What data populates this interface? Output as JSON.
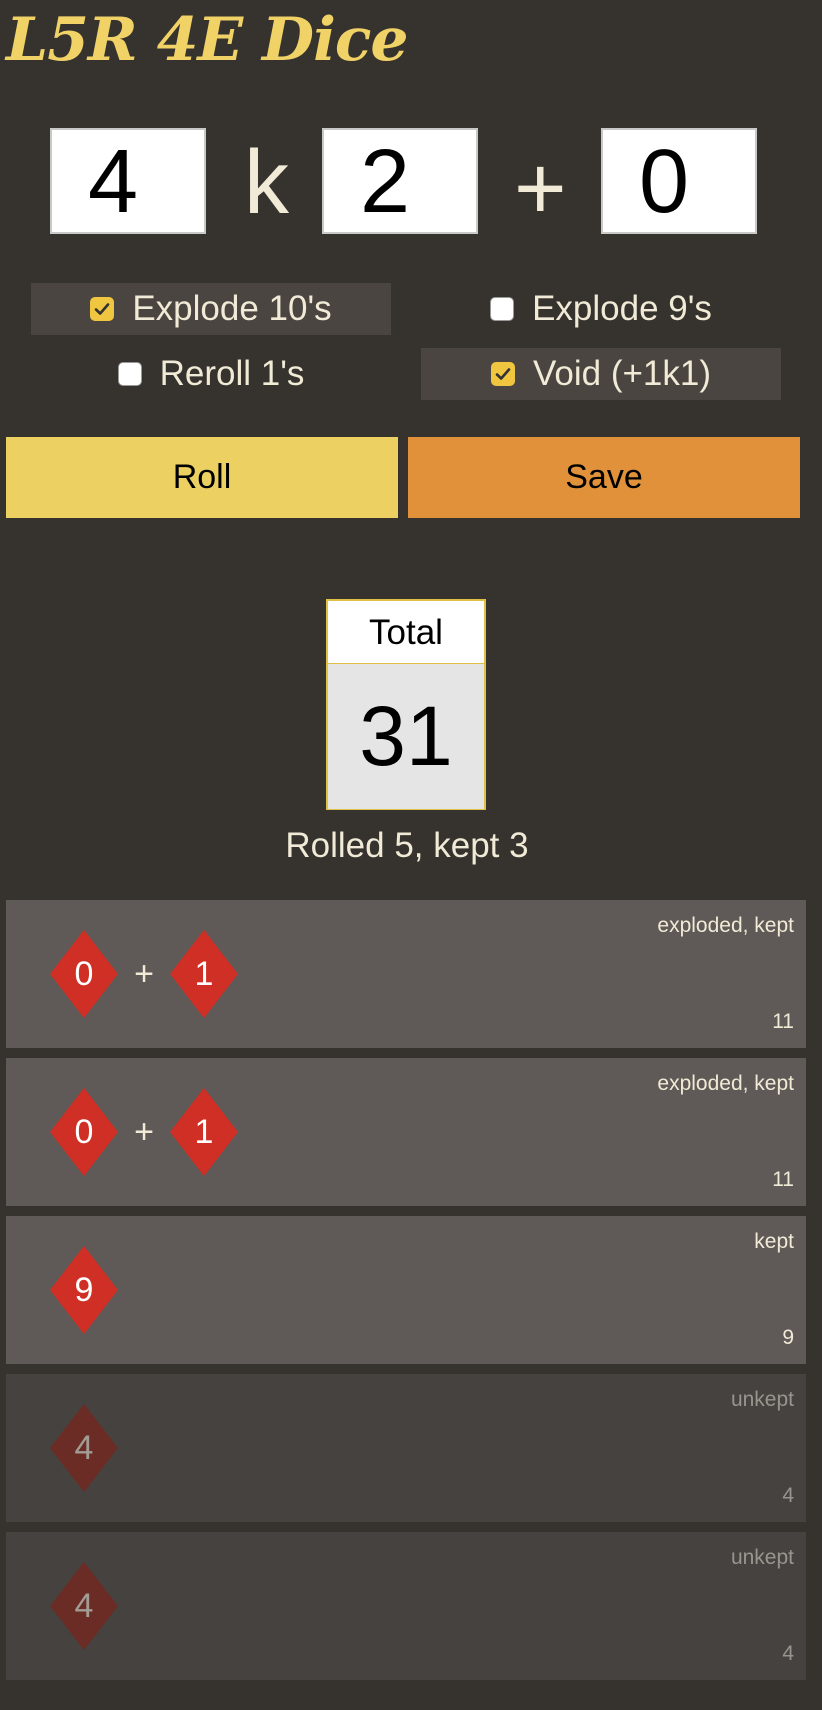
{
  "app": {
    "title": "L5R 4E Dice"
  },
  "dice": {
    "roll_value": "4",
    "k_label": "k",
    "keep_value": "2",
    "plus_label": "+",
    "bonus_value": "0"
  },
  "options": {
    "explode10": {
      "label": "Explode 10's",
      "checked": true
    },
    "explode9": {
      "label": "Explode 9's",
      "checked": false
    },
    "reroll1": {
      "label": "Reroll 1's",
      "checked": false
    },
    "void": {
      "label": "Void (+1k1)",
      "checked": true
    }
  },
  "buttons": {
    "roll_label": "Roll",
    "save_label": "Save"
  },
  "result": {
    "total_label": "Total",
    "total_value": "31",
    "summary": "Rolled 5, kept 3"
  },
  "rolls": [
    {
      "dice": [
        "0",
        "1"
      ],
      "status": "exploded, kept",
      "total": "11",
      "kept": true
    },
    {
      "dice": [
        "0",
        "1"
      ],
      "status": "exploded, kept",
      "total": "11",
      "kept": true
    },
    {
      "dice": [
        "9"
      ],
      "status": "kept",
      "total": "9",
      "kept": true
    },
    {
      "dice": [
        "4"
      ],
      "status": "unkept",
      "total": "4",
      "kept": false
    },
    {
      "dice": [
        "4"
      ],
      "status": "unkept",
      "total": "4",
      "kept": false
    }
  ],
  "colors": {
    "background": "#36322e",
    "accent": "#f0d266",
    "roll_button": "#ecd062",
    "save_button": "#e0913a",
    "die_red": "#cf2f24"
  },
  "icons": {
    "checkbox_checked": "check-icon",
    "die": "diamond-die-icon"
  }
}
